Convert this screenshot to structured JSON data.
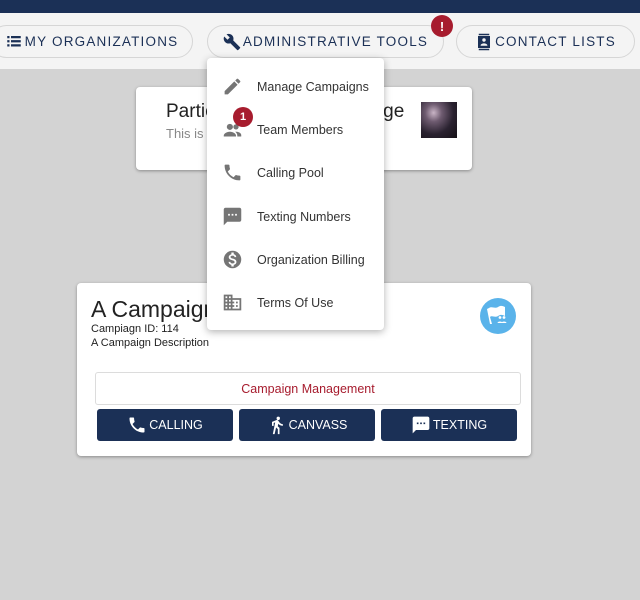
{
  "nav": {
    "my_organizations": "MY ORGANIZATIONS",
    "administrative_tools": "ADMINISTRATIVE TOOLS",
    "contact_lists": "CONTACT LISTS",
    "admin_alert_badge": "!"
  },
  "admin_menu": {
    "items": [
      {
        "label": "Manage Campaigns",
        "icon": "pencil-icon"
      },
      {
        "label": "Team Members",
        "icon": "people-icon",
        "badge": "1"
      },
      {
        "label": "Calling Pool",
        "icon": "phone-icon"
      },
      {
        "label": "Texting Numbers",
        "icon": "sms-icon"
      },
      {
        "label": "Organization Billing",
        "icon": "dollar-icon"
      },
      {
        "label": "Terms Of Use",
        "icon": "building-icon"
      }
    ]
  },
  "org_card": {
    "title_visible_left": "Partic",
    "title_visible_right": "age",
    "subtitle_visible": "This is a"
  },
  "campaign_card": {
    "title": "A Campaign",
    "campaign_id": "Campiagn ID: 114",
    "description": "A Campaign Description",
    "management_button": "Campaign Management",
    "actions": {
      "calling": "CALLING",
      "canvass": "CANVASS",
      "texting": "TEXTING"
    }
  },
  "colors": {
    "brand_navy": "#1b3056",
    "alert_red": "#a71c2e",
    "badge_blue": "#5ab3ea",
    "background": "#d3d3d3"
  }
}
